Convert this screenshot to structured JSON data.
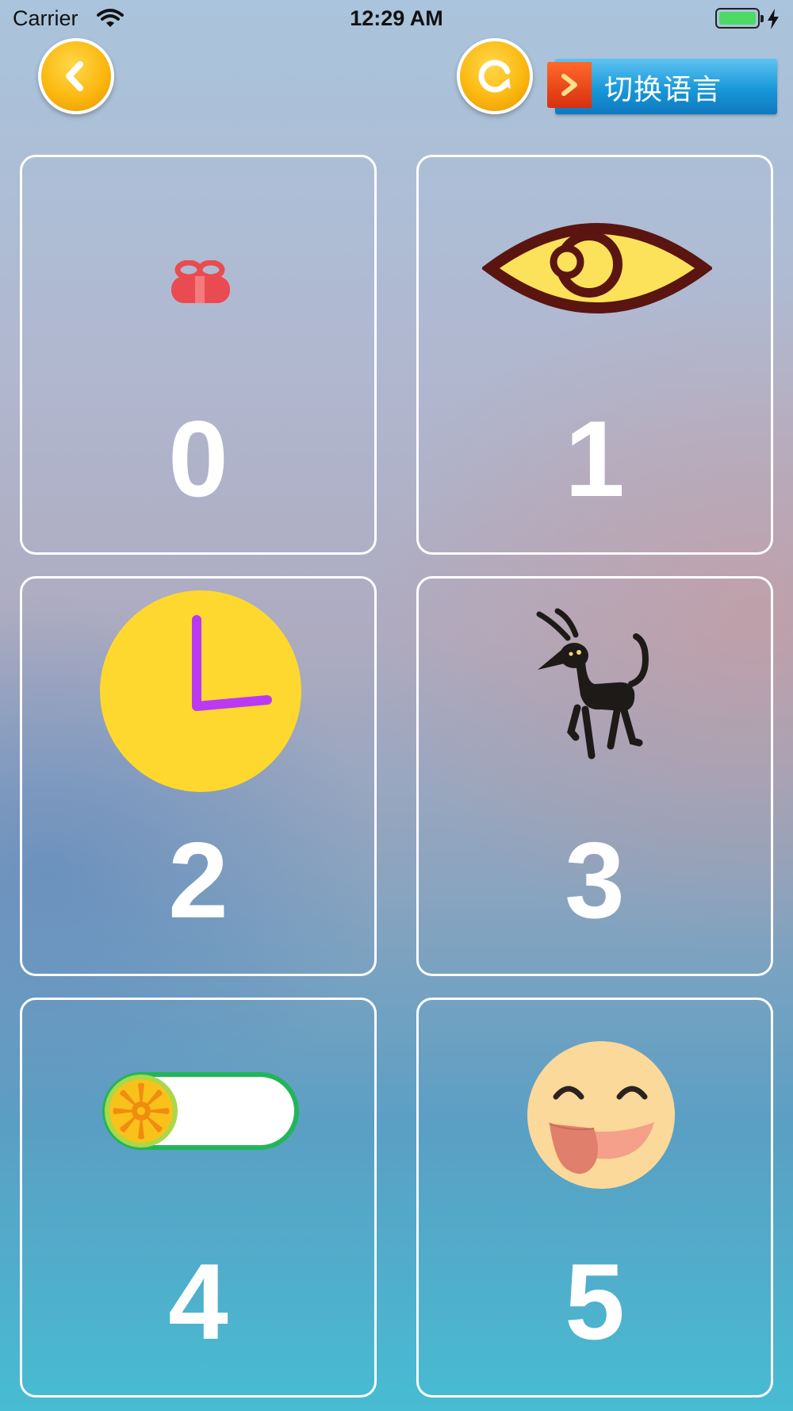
{
  "status_bar": {
    "carrier": "Carrier",
    "time": "12:29 AM"
  },
  "toolbar": {
    "back_icon": "chevron-left-icon",
    "refresh_icon": "refresh-icon",
    "language_button_label": "切换语言"
  },
  "cards": [
    {
      "number": "0",
      "icon": "gift-icon"
    },
    {
      "number": "1",
      "icon": "eye-icon"
    },
    {
      "number": "2",
      "icon": "clock-icon"
    },
    {
      "number": "3",
      "icon": "goat-icon"
    },
    {
      "number": "4",
      "icon": "orange-toggle-icon"
    },
    {
      "number": "5",
      "icon": "tongue-out-face-icon"
    }
  ],
  "colors": {
    "button_orange": "#fbb810",
    "language_blue": "#1898d8",
    "card_border": "#ffffff"
  }
}
